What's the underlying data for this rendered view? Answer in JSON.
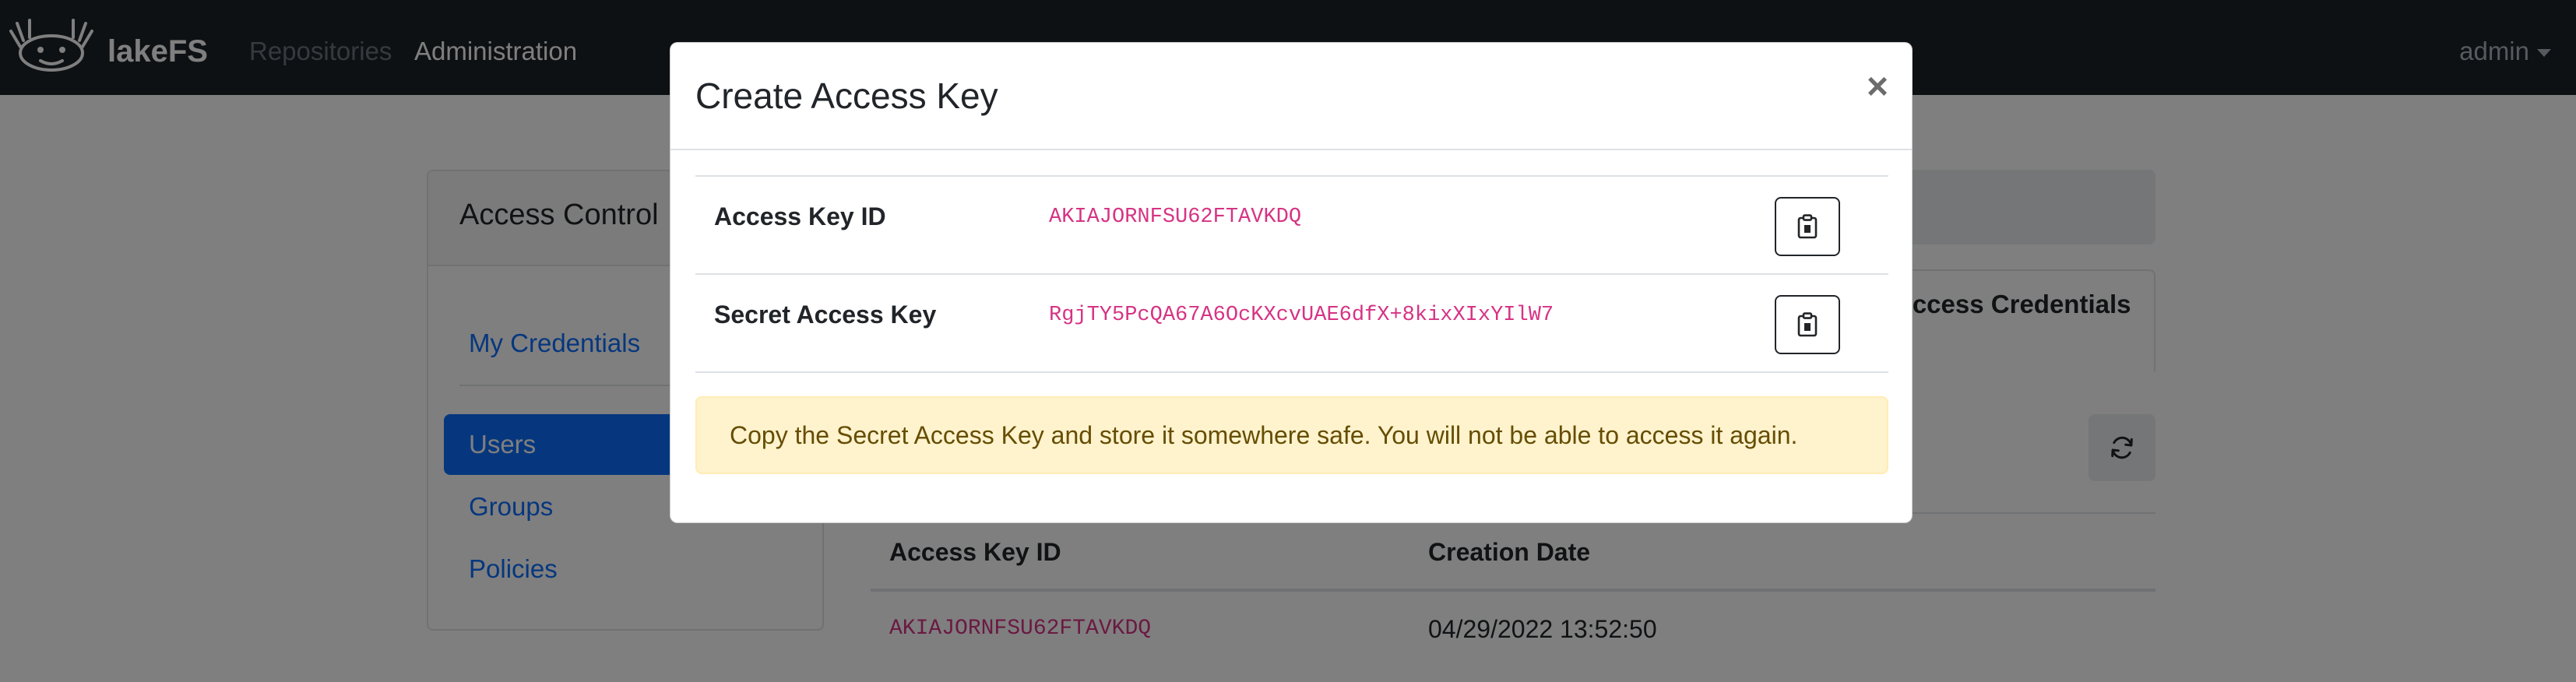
{
  "navbar": {
    "brand": "lakeFS",
    "links": [
      "Repositories",
      "Administration"
    ],
    "user": "admin"
  },
  "sidebar": {
    "header": "Access Control",
    "items": [
      "My Credentials",
      "Users",
      "Groups",
      "Policies"
    ],
    "active": "Users"
  },
  "main": {
    "active_tab": "Access Credentials",
    "table": {
      "headers": [
        "Access Key ID",
        "Creation Date"
      ],
      "rows": [
        {
          "key_id": "AKIAJORNFSU62FTAVKDQ",
          "created": "04/29/2022 13:52:50"
        }
      ]
    }
  },
  "modal": {
    "title": "Create Access Key",
    "close_label": "×",
    "rows": [
      {
        "label": "Access Key ID",
        "value": "AKIAJORNFSU62FTAVKDQ"
      },
      {
        "label": "Secret Access Key",
        "value": "RgjTY5PcQA67A6OcKXcvUAE6dfX+8kixXIxYIlW7"
      }
    ],
    "warning": "Copy the Secret Access Key and store it somewhere safe. You will not be able to access it again."
  },
  "colors": {
    "navbar_bg": "#1d2227",
    "primary": "#0d6efd",
    "code": "#d63384",
    "warning_bg": "#fff3cd",
    "warning_text": "#664d03"
  },
  "icons": [
    "lakefs-axolotl-logo",
    "chevron-down-icon",
    "refresh-icon",
    "clipboard-icon",
    "close-icon"
  ]
}
